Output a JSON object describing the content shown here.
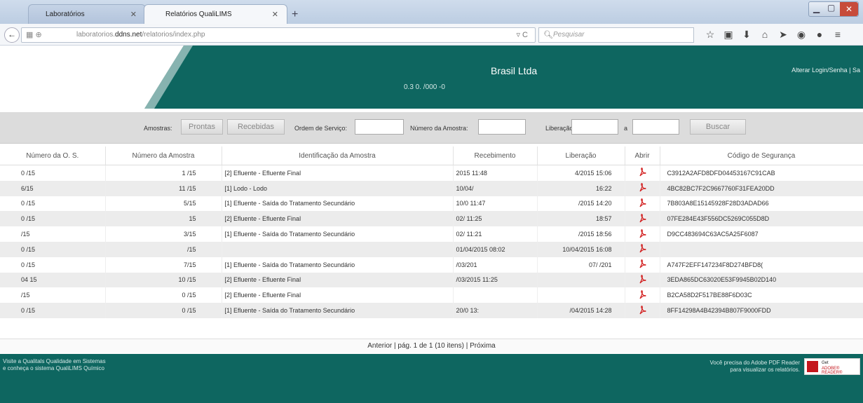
{
  "browser": {
    "tabs": [
      {
        "label": "Laboratórios"
      },
      {
        "label": "Relatórios QualiLIMS"
      }
    ],
    "url_prefix": "laboratorios.",
    "url_domain": "ddns.net",
    "url_path": "/relatorios/index.php",
    "search_placeholder": "Pesquisar"
  },
  "header": {
    "company": "Brasil  Ltda",
    "version": "0.3  0.  /000  -0",
    "top_links": "Alterar Login/Senha | Sa"
  },
  "filters": {
    "amostras_label": "Amostras:",
    "prontas": "Prontas",
    "recebidas": "Recebidas",
    "ordem_label": "Ordem de Serviço:",
    "numero_label": "Número da Amostra:",
    "liberacao_label": "Liberação:",
    "a_label": "a",
    "buscar": "Buscar"
  },
  "table": {
    "columns": [
      "Número da O. S.",
      "Número da Amostra",
      "Identificação da Amostra",
      "Recebimento",
      "Liberação",
      "Abrir",
      "Código de Segurança"
    ],
    "rows": [
      {
        "os": "0   /15",
        "amostra": "1   /15",
        "ident": "[2] Efluente - Efluente Final",
        "receb": "2015 11:48",
        "lib": "4/2015 15:06",
        "codigo": "C3912A2AFD8DFD04453167C91CAB"
      },
      {
        "os": "6/15",
        "amostra": "11   /15",
        "ident": "[1] Lodo - Lodo",
        "receb": "10/04/",
        "lib": "16:22",
        "codigo": "4BC82BC7F2C9667760F31FEA20DD"
      },
      {
        "os": "0   /15",
        "amostra": "5/15",
        "ident": "[1] Efluente - Saída do Tratamento Secundário",
        "receb": "10/0       11:47",
        "lib": "/2015 14:20",
        "codigo": "7B803A8E15145928F28D3ADAD66"
      },
      {
        "os": "0   /15",
        "amostra": "15",
        "ident": "[2] Efluente - Efluente Final",
        "receb": "02/        11:25",
        "lib": "18:57",
        "codigo": "07FE284E43F556DC5269C055D8D"
      },
      {
        "os": "/15",
        "amostra": "3/15",
        "ident": "[1] Efluente - Saída do Tratamento Secundário",
        "receb": "02/        11:21",
        "lib": "/2015 18:56",
        "codigo": "D9CC483694C63AC5A25F6087"
      },
      {
        "os": "0   /15",
        "amostra": "/15",
        "ident": "",
        "receb": "01/04/2015 08:02",
        "lib": "10/04/2015 16:08",
        "codigo": ""
      },
      {
        "os": "0   /15",
        "amostra": "7/15",
        "ident": "[1] Efluente - Saída do Tratamento Secundário",
        "receb": "/03/201",
        "lib": "07/  /201",
        "codigo": "A747F2EFF147234F8D274BFD8("
      },
      {
        "os": "04   15",
        "amostra": "10   /15",
        "ident": "[2] Efluente - Efluente Final",
        "receb": "/03/2015 11:25",
        "lib": "",
        "codigo": "3EDA865DC63020E53F9945B02D140"
      },
      {
        "os": "/15",
        "amostra": "0   /15",
        "ident": "[2] Efluente - Efluente Final",
        "receb": "",
        "lib": "",
        "codigo": "B2CA58D2F517BE88F6D03C"
      },
      {
        "os": "0   /15",
        "amostra": "0   /15",
        "ident": "[1] Efluente - Saída do Tratamento Secundário",
        "receb": "20/0        13:",
        "lib": "/04/2015 14:28",
        "codigo": "8FF14298A4B42394B807F9000FDD"
      }
    ]
  },
  "pager": "Anterior | pág. 1 de 1 (10 itens) | Próxima",
  "footer": {
    "left_line1": "Visite a Qualitals Qualidade em Sistemas",
    "left_line2": "e conheça o sistema QualiLIMS Químico",
    "right_line1": "Você precisa do Adobe PDF Reader",
    "right_line2": "para visualizar os relatórios.",
    "adobe_get": "Get",
    "adobe_reader": "ADOBE® READER®"
  }
}
